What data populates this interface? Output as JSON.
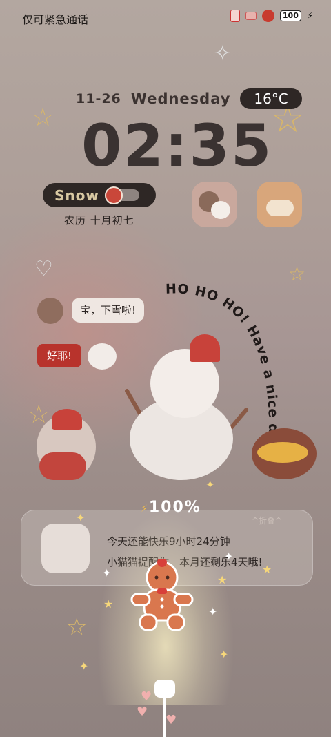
{
  "status_bar": {
    "carrier": "仅可紧急通话",
    "battery_level": "100",
    "charging_icon": "bolt-icon"
  },
  "lockscreen": {
    "date": "11-26",
    "weekday": "Wednesday",
    "temperature": "16°C",
    "time": "02:35",
    "weather_word": "Snow",
    "lunar_date": "农历  十月初七",
    "curved_text": "HO HO HO! Have a nice day!"
  },
  "chat": {
    "bubble_left": "宝，下雪啦!",
    "bubble_reply": "好耶!"
  },
  "charging": {
    "percent": "100%",
    "line1": "今天还能快乐9小时24分钟",
    "line2": "小猫猫提醒你，本月还剩乐4天哦!",
    "fold_label": "^折叠^"
  },
  "colors": {
    "accent_red": "#c8423a",
    "pill_dark": "#2e2725"
  }
}
